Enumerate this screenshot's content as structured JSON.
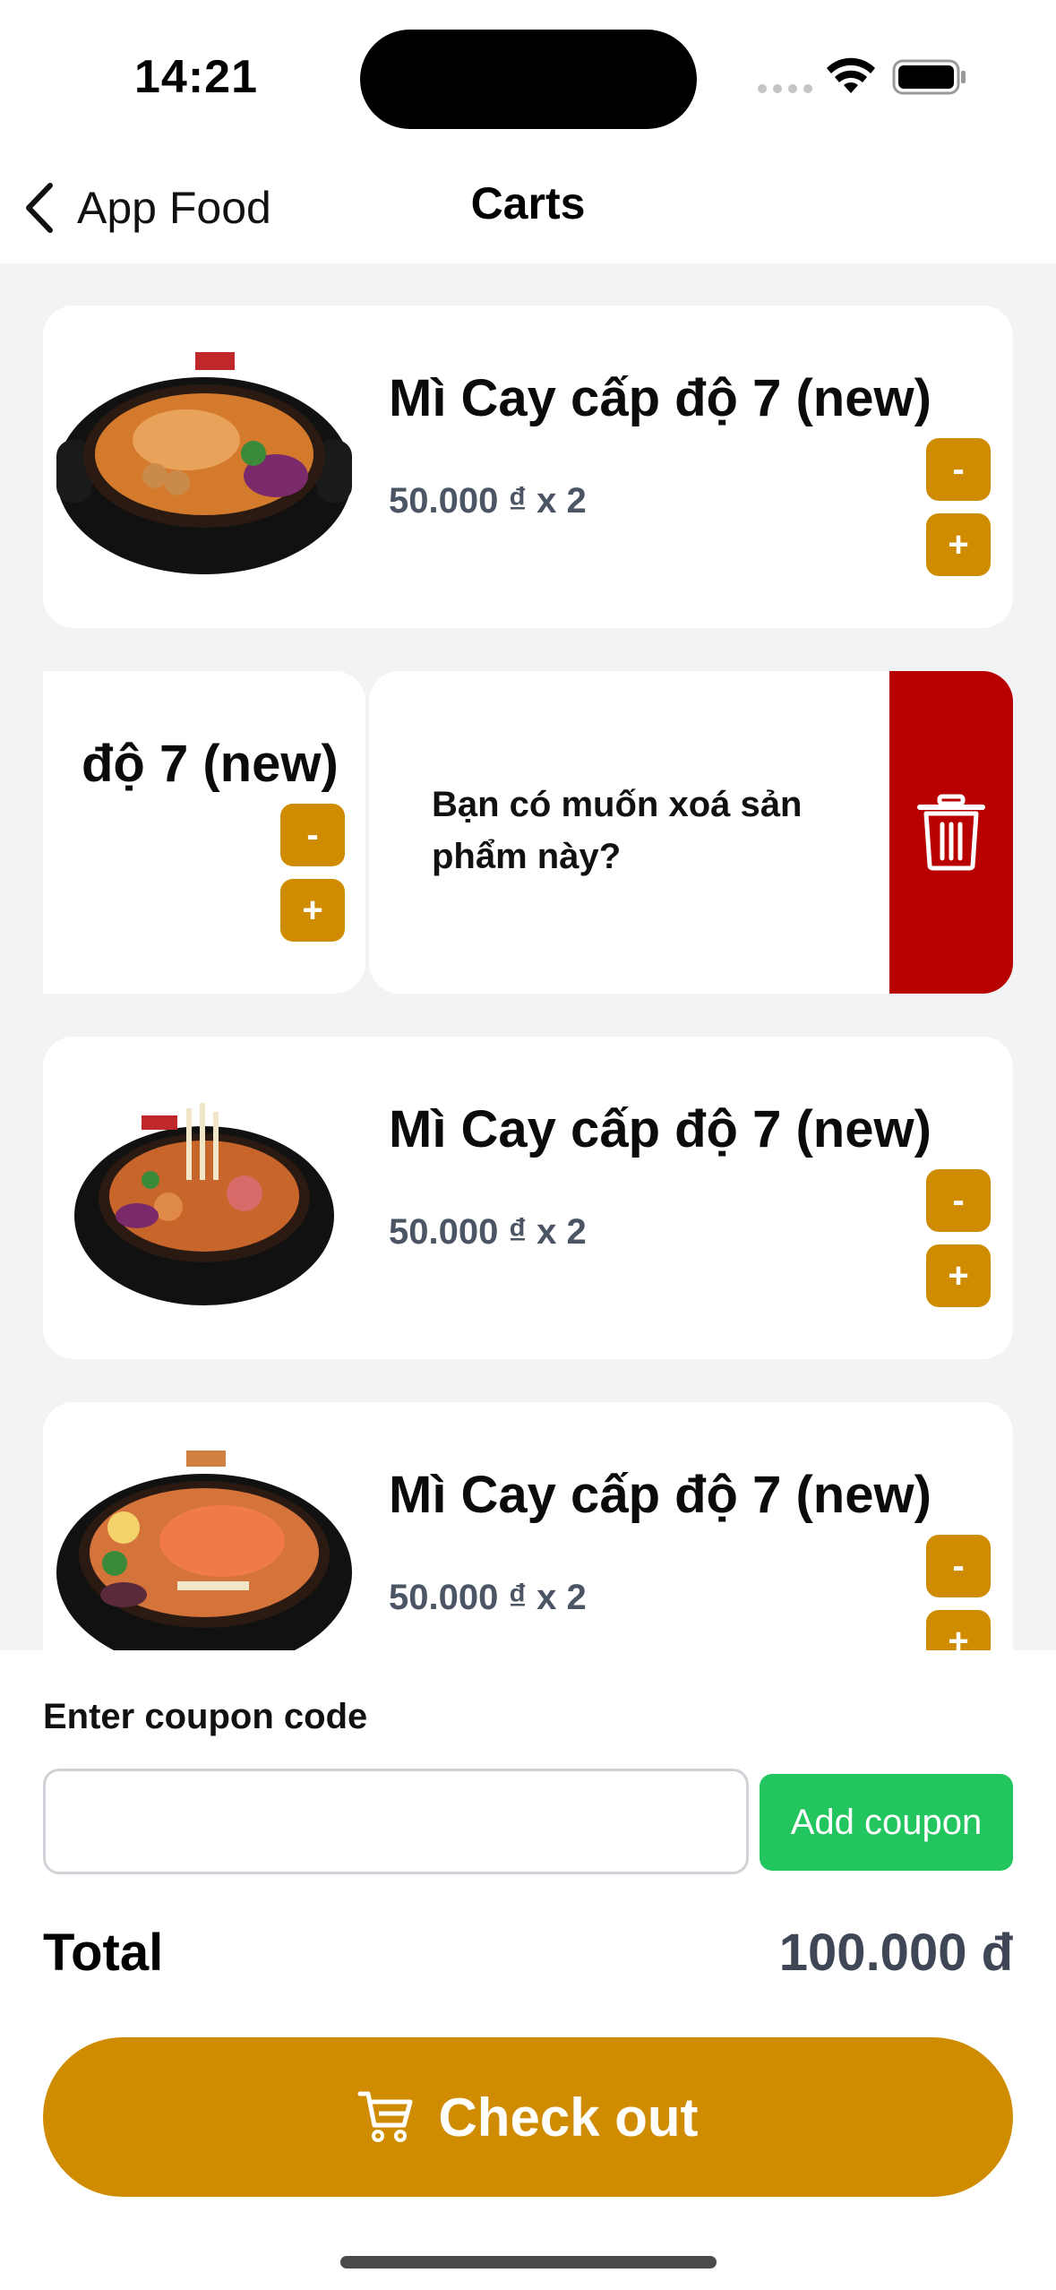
{
  "status_bar": {
    "time": "14:21"
  },
  "nav": {
    "back_label": "App Food",
    "title": "Carts"
  },
  "cart": {
    "items": [
      {
        "name": "Mì Cay cấp độ 7 (new)",
        "price_line": "50.000 ₫ x 2",
        "minus": "-",
        "plus": "+"
      },
      {
        "name": "độ 7 (new)",
        "price_line": "",
        "minus": "-",
        "plus": "+"
      },
      {
        "name": "Mì Cay cấp độ 7 (new)",
        "price_line": "50.000 ₫ x 2",
        "minus": "-",
        "plus": "+"
      },
      {
        "name": "Mì Cay cấp độ 7 (new)",
        "price_line": "50.000 ₫ x 2",
        "minus": "-",
        "plus": "+"
      }
    ],
    "delete_confirm": "Bạn có muốn xoá sản phẩm này?",
    "delete_icon": "trash-icon"
  },
  "coupon": {
    "label": "Enter coupon code",
    "value": "",
    "placeholder": "",
    "button": "Add coupon"
  },
  "summary": {
    "total_label": "Total",
    "total_value": "100.000 đ"
  },
  "checkout": {
    "label": "Check out",
    "icon": "cart-icon"
  },
  "colors": {
    "accent": "#d08c00",
    "delete": "#b80000",
    "coupon_button": "#22c55e",
    "background": "#f2f3f5"
  }
}
